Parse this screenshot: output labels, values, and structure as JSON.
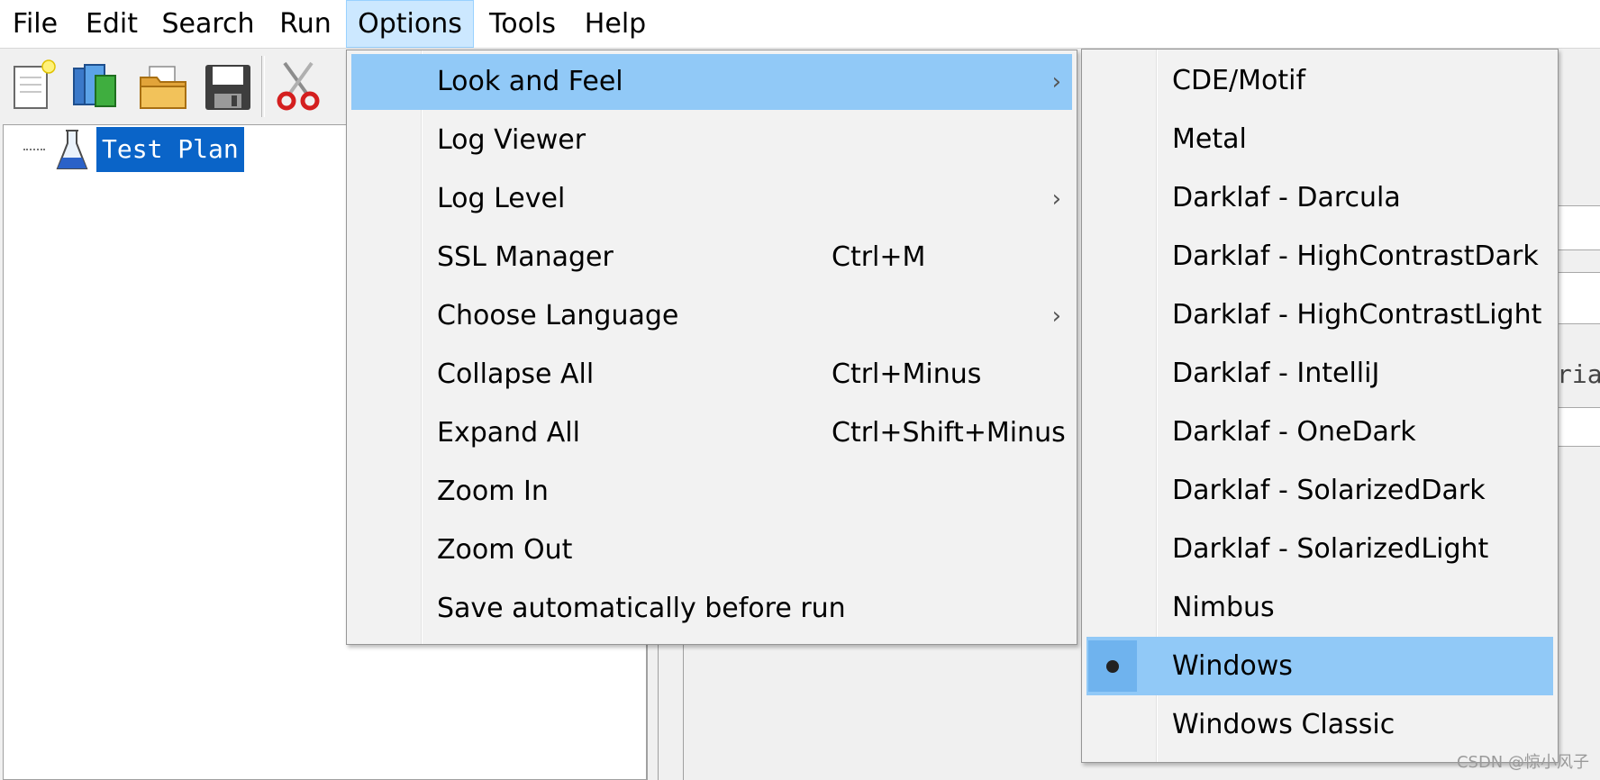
{
  "menubar": {
    "items": [
      "File",
      "Edit",
      "Search",
      "Run",
      "Options",
      "Tools",
      "Help"
    ],
    "active": "Options"
  },
  "toolbar": {
    "icons": [
      "new-template-icon",
      "templates-icon",
      "open-folder-icon",
      "save-icon",
      "cut-icon"
    ]
  },
  "tree": {
    "root_label": "Test Plan",
    "root_icon": "flask-icon",
    "selection_color": "#0a64c8"
  },
  "options_menu": {
    "items": [
      {
        "label": "Look and Feel",
        "shortcut": "",
        "submenu": true
      },
      {
        "label": "Log Viewer",
        "shortcut": "",
        "submenu": false
      },
      {
        "label": "Log Level",
        "shortcut": "",
        "submenu": true
      },
      {
        "label": "SSL Manager",
        "shortcut": "Ctrl+M",
        "submenu": false
      },
      {
        "label": "Choose Language",
        "shortcut": "",
        "submenu": true
      },
      {
        "label": "Collapse All",
        "shortcut": "Ctrl+Minus",
        "submenu": false
      },
      {
        "label": "Expand All",
        "shortcut": "Ctrl+Shift+Minus",
        "submenu": false
      },
      {
        "label": "Zoom In",
        "shortcut": "",
        "submenu": false
      },
      {
        "label": "Zoom Out",
        "shortcut": "",
        "submenu": false
      },
      {
        "label": "Save automatically before run",
        "shortcut": "",
        "submenu": false
      }
    ],
    "submenu_arrow": "›",
    "highlight_color": "#91c9f7"
  },
  "look_and_feel_menu": {
    "items": [
      "CDE/Motif",
      "Metal",
      "Darklaf - Darcula",
      "Darklaf - HighContrastDark",
      "Darklaf - HighContrastLight",
      "Darklaf - IntelliJ",
      "Darklaf - OneDark",
      "Darklaf - SolarizedDark",
      "Darklaf - SolarizedLight",
      "Nimbus",
      "Windows",
      "Windows Classic"
    ],
    "selected": "Windows"
  },
  "background": {
    "peek_text": "rial"
  },
  "watermark": "CSDN @惊小风子"
}
